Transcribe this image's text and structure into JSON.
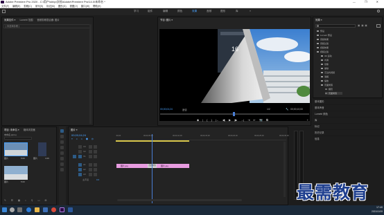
{
  "title_bar": {
    "title": "Adobe Premiere Pro 2020 - C:\\用户\\shbp\\文档\\Adobe\\Premiere Pro\\14.0\\未命名 *",
    "controls": "—  ❐  ✕"
  },
  "menu_bar": {
    "items": [
      "文件(F)",
      "编辑(E)",
      "剪辑(C)",
      "序列(S)",
      "标记(M)",
      "图形(G)",
      "视图(V)",
      "窗口(W)",
      "帮助(H)"
    ]
  },
  "workspaces": {
    "items": [
      "学习",
      "组件",
      "编辑",
      "颜色",
      "效果",
      "音频",
      "图形",
      "库"
    ],
    "active": "效果",
    "more": "»"
  },
  "source_panel": {
    "tabs": [
      "效果控件 ≡",
      "Lumetri 范围",
      "音频剪辑混合器: 图片"
    ],
    "no_clip": "( 未选择剪辑 )"
  },
  "program_monitor": {
    "tab": "节目: 图片 ≡",
    "timecode_left": "00;00;04;24",
    "fit_label": "适合",
    "quality_label": "1/2",
    "timecode_right": "00;00;10;00",
    "transport": [
      "◆",
      "|",
      "{",
      "}",
      "|←",
      "◀|",
      "▶",
      "|▶",
      "→|",
      "⇥",
      "⇤",
      "📷",
      "⧉"
    ]
  },
  "effects_panel": {
    "tab": "效果 ≡",
    "search_placeholder": "",
    "tree": [
      {
        "label": "预设",
        "indent": 0,
        "selected": false
      },
      {
        "label": "Lumetri 预设",
        "indent": 0,
        "selected": false
      },
      {
        "label": "音频效果",
        "indent": 0,
        "selected": false
      },
      {
        "label": "音频过渡",
        "indent": 0,
        "selected": false
      },
      {
        "label": "视频效果",
        "indent": 0,
        "selected": false
      },
      {
        "label": "视频过渡",
        "indent": 0,
        "selected": false
      },
      {
        "label": "3D 运动",
        "indent": 1,
        "selected": false
      },
      {
        "label": "内滑",
        "indent": 1,
        "selected": false
      },
      {
        "label": "划像",
        "indent": 1,
        "selected": false
      },
      {
        "label": "擦除",
        "indent": 1,
        "selected": false
      },
      {
        "label": "沉浸式视频",
        "indent": 1,
        "selected": false
      },
      {
        "label": "溶解",
        "indent": 1,
        "selected": false
      },
      {
        "label": "缩放",
        "indent": 1,
        "selected": false
      },
      {
        "label": "页面剥落",
        "indent": 1,
        "selected": false
      },
      {
        "label": "翻页",
        "indent": 2,
        "selected": false
      },
      {
        "label": "页面剥落",
        "indent": 2,
        "selected": true
      }
    ],
    "lower_panels": [
      "基本图形",
      "基本声音",
      "Lumetri 颜色",
      "库",
      "标记",
      "历史记录",
      "信息"
    ]
  },
  "project_panel": {
    "tabs": [
      "项目: 未命名 ≡",
      "媒体浏览器"
    ],
    "project_file": "未命名.prproj",
    "items": [
      {
        "label": "图片",
        "meta": "5:00"
      },
      {
        "label": "图片",
        "meta": "4:29"
      },
      {
        "label": "图片",
        "meta": "5:00"
      }
    ]
  },
  "timeline": {
    "tab": "图片 ≡",
    "timecode": "00;00;04;24",
    "ruler": [
      ":00;00",
      "00;00;05;00",
      "00;00;10;00",
      "00;00;15;00",
      "00;00;20;00",
      "00;00;25;00",
      "00;00;30;00"
    ],
    "video_tracks": [
      "V3",
      "V2",
      "V1"
    ],
    "audio_tracks": [
      "A1",
      "A2",
      "A3"
    ],
    "master": "主声道",
    "master_value": "0.0",
    "clips": [
      {
        "label": "图片.jpg"
      },
      {
        "label": "图片.jpg"
      }
    ],
    "transition_label": "页面剥落"
  },
  "watermark": {
    "text": "最需教育"
  },
  "taskbar": {
    "time": "17:40",
    "date": "2021/10/19",
    "icons": [
      "windows-icon",
      "search-icon",
      "taskview-icon",
      "ie-icon",
      "folder-icon",
      "store-icon",
      "chrome-icon",
      "premiere-icon",
      "word-icon"
    ]
  },
  "colors": {
    "accent_blue": "#4aa3ff",
    "clip_pink": "#e79ce0",
    "playhead": "#4a7fd6",
    "watermark": "#1f3f8f"
  }
}
